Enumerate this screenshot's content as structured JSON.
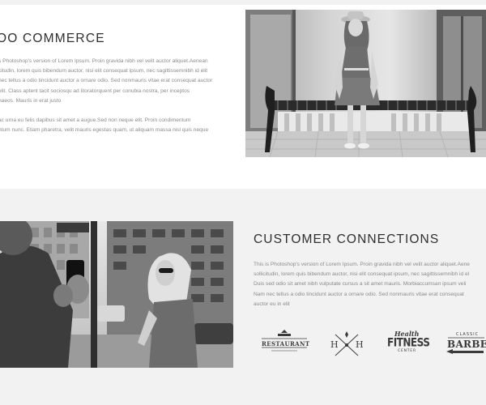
{
  "section_one": {
    "title": "OO COMMERCE",
    "paragraph_1": [
      "s Photoshop's version of Lorem Ipsum. Proin gravida nibh vel velit auctor aliquet.Aenean",
      "citudin, lorem quis bibendum auctor, nisi elit consequat ipsum, nec sagittissemnibh id elit",
      "nec tellus a odio tincidunt auctor a ornare odio. Sed nonmauris vitae erat consequat auctor",
      "elit. Class aptent tacit sociosqu ad litoratorquent per conubia nostra, per inceptos",
      "naeos. Mauris in erat justo"
    ],
    "paragraph_2": [
      "ac urna eu felis dapibus sit amet a augue.Sed non neque elit. Proin condimentum",
      "ntum nunc. Etiam pharetra,  velit mauris egestas quam, ut aliquam massa nisl quis neque"
    ]
  },
  "section_two": {
    "title": "CUSTOMER CONNECTIONS",
    "paragraph": [
      "This is Photoshop's version of Lorem Ipsum. Proin gravida nibh vel velit auctor aliquet.Aene",
      "sollicitudin, lorem quis bibendum auctor, nisi elit consequat ipsum, nec sagittissemnibh id el",
      "Duis sed odio sit amet nibh vulputate cursus a sit amet mauris. Morbiaccumsan ipsum veli",
      "Nam nec tellus a odio tincidunt auctor a ornare odio. Sed nonmauris vitae erat consequat",
      "auctor eu in elit"
    ],
    "logos": {
      "restaurant": "RESTAURANT",
      "hh_left": "H",
      "hh_right": "H",
      "fitness_script": "Health",
      "fitness": "FITNESS",
      "fitness_sub": "CENTER",
      "barber_classic": "CLASSIC",
      "barber": "BARBER"
    }
  }
}
